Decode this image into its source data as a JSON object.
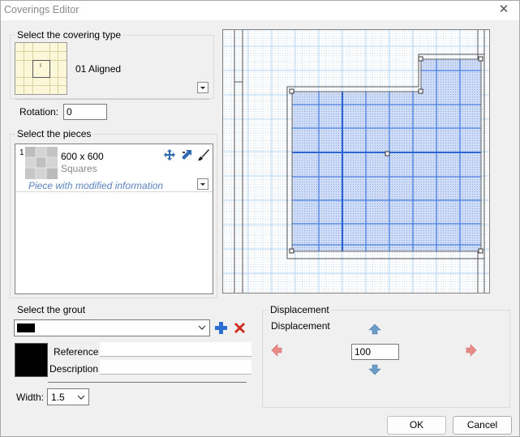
{
  "window": {
    "title": "Coverings Editor",
    "close_glyph": "✕"
  },
  "covering_type": {
    "legend": "Select the covering type",
    "selected": "01 Aligned",
    "thumbnail_mark": "I",
    "icon": "tile-grid-thumbnail"
  },
  "rotation": {
    "label": "Rotation:",
    "value": "0"
  },
  "pieces": {
    "legend": "Select the pieces",
    "items": [
      {
        "index": "1",
        "size": "600 x 600",
        "name": "Squares",
        "note": "Piece with modified information",
        "icons": [
          "move-tile-icon",
          "flip-tile-icon",
          "brush-icon"
        ]
      }
    ]
  },
  "grout": {
    "legend": "Select the grout",
    "selected_color": "#000000",
    "reference_label": "Reference",
    "reference_value": "",
    "description_label": "Description",
    "description_value": "",
    "width_label": "Width:",
    "width_value": "1.5",
    "add_icon": "plus-icon",
    "delete_icon": "delete-x-icon"
  },
  "displacement": {
    "legend": "Displacement",
    "label": "Displacement",
    "value": "100",
    "up_icon": "arrow-up-icon",
    "down_icon": "arrow-down-icon",
    "left_icon": "arrow-left-icon",
    "right_icon": "arrow-right-icon"
  },
  "buttons": {
    "ok": "OK",
    "cancel": "Cancel"
  },
  "colors": {
    "preview_fill": "#cfdcf8",
    "preview_grid_major": "#4a7fe0",
    "preview_grid_minor": "#b8d8f4",
    "thumbnail_bg": "#fbf7d8",
    "link_text": "#5b84c4",
    "grey_text": "#8a8a8a",
    "plus": "#2c6fd1",
    "delete": "#d12a1e",
    "arrow_blue": "#6b9bc8",
    "arrow_red": "#e88a86"
  }
}
